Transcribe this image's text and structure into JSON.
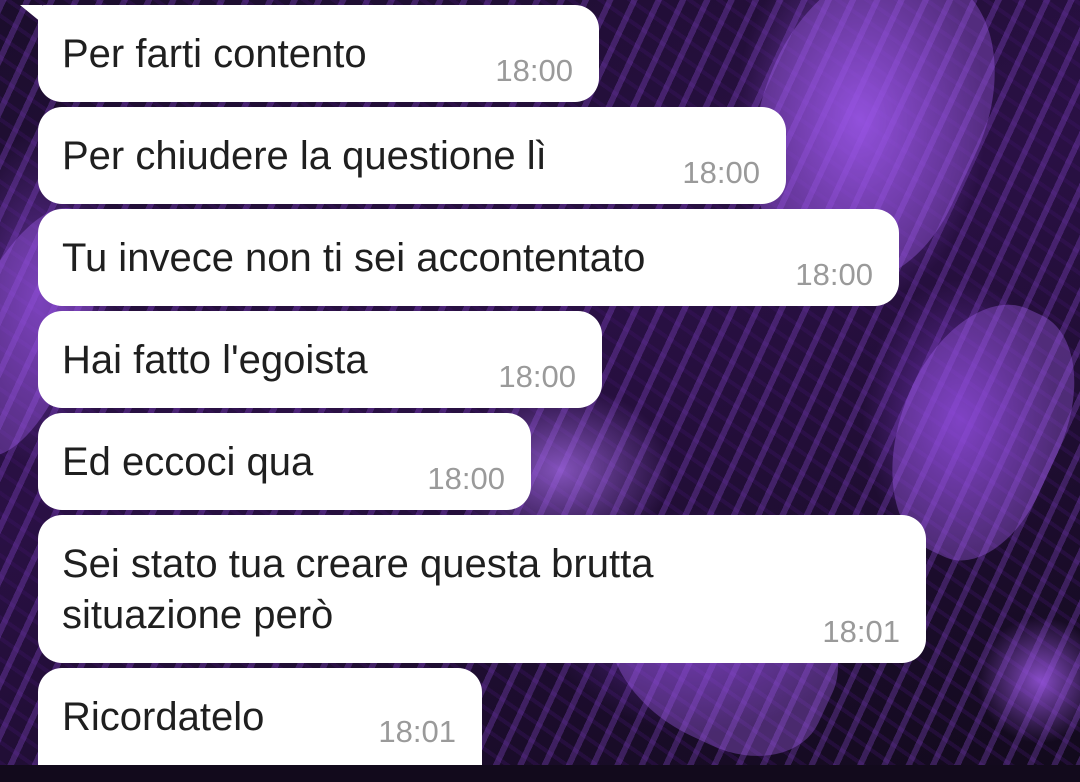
{
  "conversation": {
    "messages": [
      {
        "text": "Per farti contento",
        "time": "18:00"
      },
      {
        "text": "Per chiudere la questione lì",
        "time": "18:00"
      },
      {
        "text": "Tu invece non ti sei accontentato",
        "time": "18:00"
      },
      {
        "text": "Hai fatto l'egoista",
        "time": "18:00"
      },
      {
        "text": "Ed eccoci qua",
        "time": "18:00"
      },
      {
        "text": "Sei stato tua creare questa brutta\nsituazione però",
        "time": "18:01"
      },
      {
        "text": "Ricordatelo",
        "time": "18:01"
      }
    ]
  },
  "theme": {
    "bubble_color": "#ffffff",
    "text_color": "#1f1f1f",
    "time_color": "#9a9a9a",
    "wallpaper_accent": "#9650e6"
  }
}
